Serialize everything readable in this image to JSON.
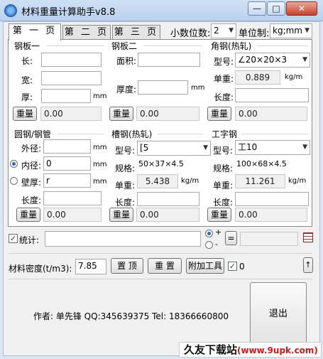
{
  "window": {
    "title": "材料重量计算助手v8.8",
    "minimize": "—",
    "maximize": "□",
    "close": "✕"
  },
  "tabs": [
    "第 一 页",
    "第 二 页",
    "第 三 页"
  ],
  "header": {
    "decimal_label": "小数位数:",
    "decimal_value": "2",
    "unit_label": "单位制:",
    "unit_value": "kg;mm"
  },
  "plate1": {
    "title": "钢板一",
    "len_label": "长:",
    "wid_label": "宽:",
    "thk_label": "厚:",
    "mm": "mm",
    "weight_btn": "重量",
    "result": "0.00"
  },
  "plate2": {
    "title": "钢板二",
    "area_label": "面积:",
    "thk_label": "厚度:",
    "mm": "mm",
    "weight_btn": "重量",
    "result": "0.00"
  },
  "angle": {
    "title": "角钢(热轧)",
    "type_label": "型号:",
    "type_value": "∠20×20×3",
    "unit_label": "单重:",
    "unit_value": "0.889",
    "unit_units": "kg/m",
    "len_label": "长度:",
    "weight_btn": "重量",
    "result": "0.00"
  },
  "tube": {
    "title": "圆钢/钢管",
    "od_label": "外径:",
    "id_label": "内径:",
    "id_value": "0",
    "wall_label": "壁厚:",
    "wall_value": "r",
    "len_label": "长度:",
    "mm": "mm",
    "weight_btn": "重量",
    "result": "0.00"
  },
  "channel": {
    "title": "槽钢(热轧)",
    "type_label": "型号:",
    "type_value": "[5",
    "spec_label": "规格:",
    "spec_value": "50×37×4.5",
    "unit_label": "单重:",
    "unit_value": "5.438",
    "unit_units": "kg/m",
    "len_label": "长度:",
    "weight_btn": "重量",
    "result": "0.00"
  },
  "ibeam": {
    "title": "工字钢",
    "type_label": "型号:",
    "type_value": "工10",
    "spec_label": "规格:",
    "spec_value": "100×68×4.5",
    "unit_label": "单重:",
    "unit_value": "11.261",
    "unit_units": "kg/m",
    "len_label": "长度:",
    "weight_btn": "重量",
    "result": "0.00"
  },
  "stats": {
    "check": "✓",
    "label": "统计:",
    "plus": "+",
    "minus": "-",
    "equals_btn": "="
  },
  "density": {
    "label": "材料密度(t/m3):",
    "value": "7.85",
    "top_btn": "置 顶",
    "reset_btn": "重 置",
    "tools_btn": "附加工具",
    "check": "✓",
    "zero": "0",
    "up_arrow": "↑"
  },
  "footer": {
    "author": "作者: 单先锋 QQ:345639375 Tel: 18366660800",
    "exit_btn": "退出"
  },
  "watermark": {
    "text": "久友下载站",
    "url": "(www.9upk.com)"
  }
}
